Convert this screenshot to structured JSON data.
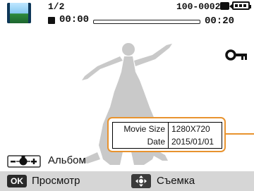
{
  "status_bar": {
    "counter": "1/2",
    "elapsed_time": "00:00",
    "file_id": "100-0002",
    "remaining_time": "00:20",
    "playback_progress": 0
  },
  "icons": {
    "thumbnail": "landscape-thumbnail-icon",
    "stop": "stop-icon",
    "video": "video-icon",
    "battery": "battery-icon",
    "protect": "key-icon",
    "zoom": "zoom-lever-icon",
    "ok": "ok-key-icon",
    "dpad": "dpad-key-icon"
  },
  "info_box": {
    "rows": [
      {
        "label": "Movie Size",
        "value": "1280X720"
      },
      {
        "label": "Date",
        "value": "2015/01/01"
      }
    ]
  },
  "zoom_row": {
    "label": "Альбом"
  },
  "bottom_bar": {
    "ok_key": "OK",
    "ok_label": "Просмотр",
    "dpad_label": "Съемка"
  },
  "colors": {
    "accent_orange": "#e8932f",
    "bottom_bar_bg": "#d6d6d6",
    "figure_gray": "#c9c9c9"
  }
}
